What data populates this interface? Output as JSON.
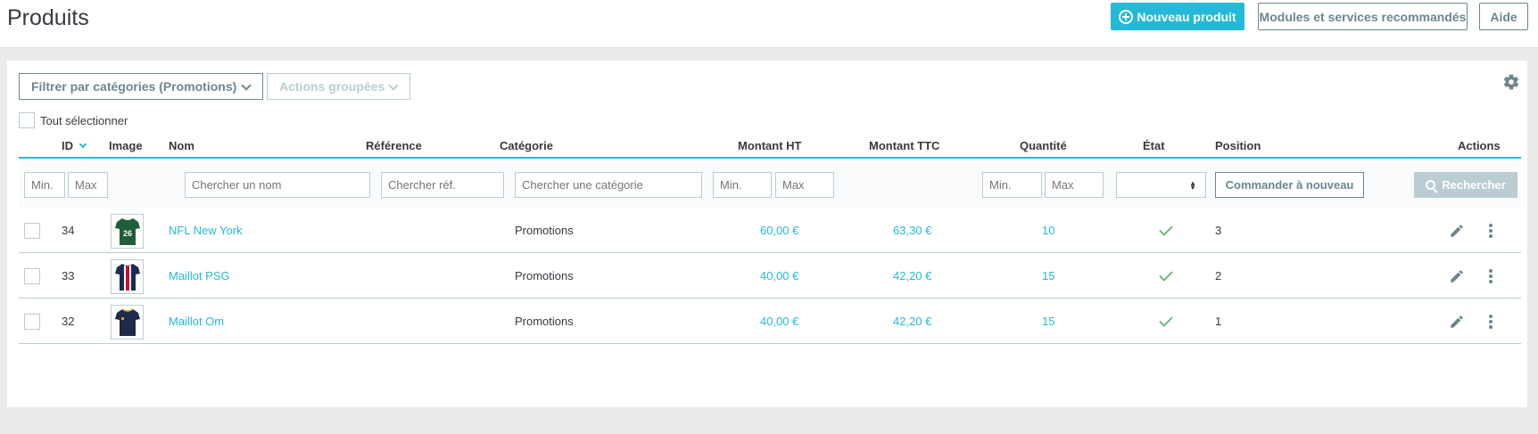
{
  "header": {
    "title": "Produits",
    "new_product": "Nouveau produit",
    "modules": "Modules et services recommandés",
    "help": "Aide"
  },
  "toolbar": {
    "category_filter": "Filtrer par catégories (Promotions)",
    "bulk_actions": "Actions groupées",
    "select_all": "Tout sélectionner"
  },
  "columns": {
    "id": "ID",
    "image": "Image",
    "name": "Nom",
    "reference": "Référence",
    "category": "Catégorie",
    "price_ht": "Montant HT",
    "price_ttc": "Montant TTC",
    "quantity": "Quantité",
    "status": "État",
    "position": "Position",
    "actions": "Actions"
  },
  "filters": {
    "min": "Min.",
    "max": "Max",
    "name_placeholder": "Chercher un nom",
    "ref_placeholder": "Chercher réf.",
    "category_placeholder": "Chercher une catégorie",
    "reorder": "Commander à nouveau",
    "search": "Rechercher"
  },
  "rows": [
    {
      "id": "34",
      "name": "NFL New York",
      "category": "Promotions",
      "price_ht": "60,00 €",
      "price_ttc": "63,30 €",
      "quantity": "10",
      "active": true,
      "position": "3",
      "thumb_color": "#1f5e3a",
      "thumb_number": "26"
    },
    {
      "id": "33",
      "name": "Maillot PSG",
      "category": "Promotions",
      "price_ht": "40,00 €",
      "price_ttc": "42,20 €",
      "quantity": "15",
      "active": true,
      "position": "2",
      "thumb_color": "#1b2a52",
      "thumb_number": ""
    },
    {
      "id": "32",
      "name": "Maillot Om",
      "category": "Promotions",
      "price_ht": "40,00 €",
      "price_ttc": "42,20 €",
      "quantity": "15",
      "active": true,
      "position": "1",
      "thumb_color": "#1e2a4a",
      "thumb_number": ""
    }
  ],
  "colors": {
    "accent": "#25b9d7",
    "success": "#70b580",
    "muted": "#6c868e",
    "border": "#bbcdd2"
  }
}
